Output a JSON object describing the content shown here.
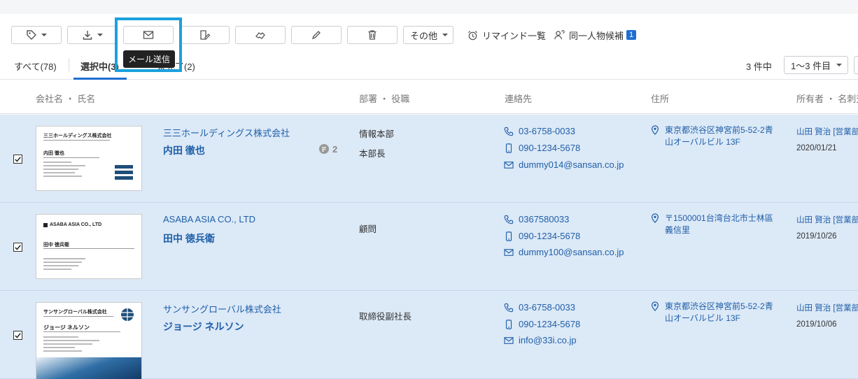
{
  "toolbar": {
    "other_label": "その他",
    "remind_label": "リマインド一覧",
    "same_person_label": "同一人物候補",
    "same_person_count": "1",
    "tooltip": "メール送信"
  },
  "tabs": {
    "all": "すべて(78)",
    "selected": "選択中(3)",
    "incomplete": "未完了(2)"
  },
  "pagination": {
    "count": "3 件中",
    "range": "1〜3 件目"
  },
  "columns": {
    "name": "会社名 ・ 氏名",
    "dept": "部署 ・ 役職",
    "contact": "連絡先",
    "address": "住所",
    "owner": "所有者 ・ 名刺交"
  },
  "rows": [
    {
      "card_company": "三三ホールディングス株式会社",
      "card_name": "内田 徹也",
      "company": "三三ホールディングス株式会社",
      "name": "内田 徹也",
      "comments": "2",
      "dept": "情報本部",
      "title": "本部長",
      "phone": "03-6758-0033",
      "mobile": "090-1234-5678",
      "email": "dummy014@sansan.co.jp",
      "address": "東京都渋谷区神宮前5-52-2青山オーバルビル 13F",
      "owner": "山田 賢治 [営業部",
      "date": "2020/01/21"
    },
    {
      "card_company": "ASABA ASIA CO., LTD",
      "card_name": "田中 徳兵衛",
      "company": "ASABA ASIA CO., LTD",
      "name": "田中 徳兵衛",
      "dept": "顧問",
      "title": "",
      "phone": "0367580033",
      "mobile": "090-1234-5678",
      "email": "dummy100@sansan.co.jp",
      "address": "〒1500001台湾台北市士林區義信里",
      "owner": "山田 賢治 [営業部",
      "date": "2019/10/26"
    },
    {
      "card_company": "サンサングローバル株式会社",
      "card_name": "ジョージ ネルソン",
      "company": "サンサングローバル株式会社",
      "name": "ジョージ ネルソン",
      "dept": "取締役副社長",
      "title": "",
      "phone": "03-6758-0033",
      "mobile": "090-1234-5678",
      "email": "info@33i.co.jp",
      "address": "東京都渋谷区神宮前5-52-2青山オーバルビル 13F",
      "owner": "山田 賢治 [営業部",
      "date": "2019/10/06"
    }
  ]
}
